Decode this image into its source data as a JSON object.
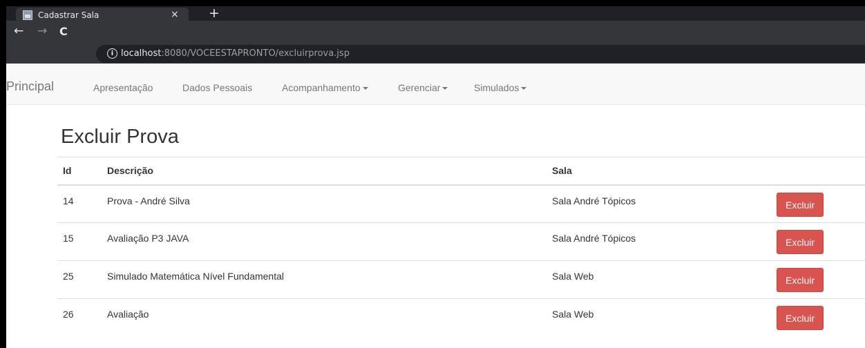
{
  "browser": {
    "tab_title": "Cadastrar Sala",
    "tab_close": "×",
    "new_tab": "+",
    "url_host": "localhost",
    "url_rest": ":8080/VOCEESTAPRONTO/excluirprova.jsp"
  },
  "navbar": {
    "brand": "Principal",
    "items": [
      {
        "label": "Apresentação",
        "dropdown": false
      },
      {
        "label": "Dados Pessoais",
        "dropdown": false
      },
      {
        "label": "Acompanhamento",
        "dropdown": true
      },
      {
        "label": "Gerenciar",
        "dropdown": true
      },
      {
        "label": "Simulados",
        "dropdown": true
      }
    ]
  },
  "main": {
    "title": "Excluir Prova",
    "columns": [
      "Id",
      "Descrição",
      "Sala",
      ""
    ],
    "rows": [
      {
        "id": "14",
        "descricao": "Prova - André Silva",
        "sala": "Sala André Tópicos",
        "action": "Excluir"
      },
      {
        "id": "15",
        "descricao": "Avaliação P3 JAVA",
        "sala": "Sala André Tópicos",
        "action": "Excluir"
      },
      {
        "id": "25",
        "descricao": "Simulado Matemática Nível Fundamental",
        "sala": "Sala Web",
        "action": "Excluir"
      },
      {
        "id": "26",
        "descricao": "Avaliação",
        "sala": "Sala Web",
        "action": "Excluir"
      }
    ]
  },
  "colors": {
    "danger": "#d9534f",
    "navbar_bg": "#f8f8f8",
    "chrome_dark": "#202124"
  }
}
